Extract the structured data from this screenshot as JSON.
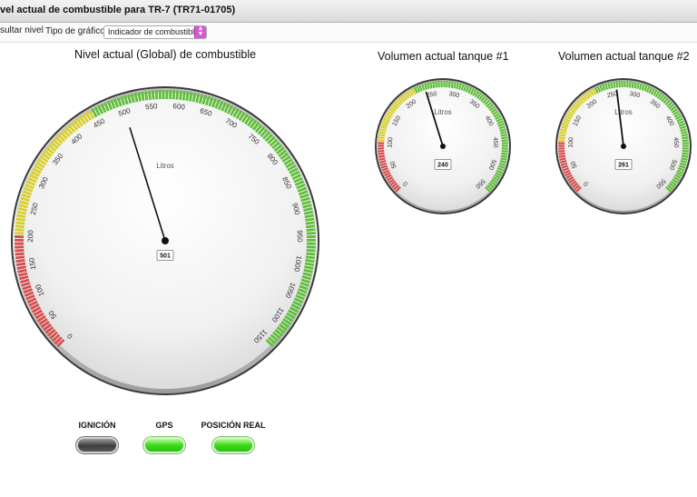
{
  "window": {
    "title": "vel actual de combustible para TR-7 (TR71-01705)"
  },
  "toolbar": {
    "consult_button": "sultar nivel",
    "chart_type_label": "Tipo de gráfico",
    "chart_type_value": "Indicador de combustible"
  },
  "colors": {
    "green": "#5fbf3a",
    "yellow": "#d9d02a",
    "red": "#d94c4c",
    "indicator_on": "#3cd81a",
    "indicator_off": "#3c3c3c"
  },
  "gauges": [
    {
      "title": "Nivel actual (Global) de combustible",
      "unit": "Litros",
      "value": 501,
      "readout": "501",
      "min": 0,
      "max": 1150,
      "ticks": [
        "0",
        "50",
        "100",
        "150",
        "200",
        "250",
        "300",
        "350",
        "400",
        "450",
        "500",
        "550",
        "600",
        "650",
        "700",
        "750",
        "800",
        "850",
        "900",
        "950",
        "1000",
        "1050",
        "1100",
        "1150"
      ],
      "bands": [
        {
          "from": 0,
          "to": 200,
          "color": "red"
        },
        {
          "from": 200,
          "to": 450,
          "color": "yellow"
        },
        {
          "from": 450,
          "to": 1150,
          "color": "green"
        }
      ]
    },
    {
      "title": "Volumen actual tanque #1",
      "unit": "Litros",
      "value": 240,
      "readout": "240",
      "min": 0,
      "max": 550,
      "ticks": [
        "0",
        "50",
        "100",
        "150",
        "200",
        "250",
        "300",
        "350",
        "400",
        "450",
        "500",
        "550"
      ],
      "bands": [
        {
          "from": 0,
          "to": 100,
          "color": "red"
        },
        {
          "from": 100,
          "to": 220,
          "color": "yellow"
        },
        {
          "from": 220,
          "to": 550,
          "color": "green"
        }
      ]
    },
    {
      "title": "Volumen actual tanque #2",
      "unit": "Litros",
      "value": 261,
      "readout": "261",
      "min": 0,
      "max": 550,
      "ticks": [
        "0",
        "50",
        "100",
        "150",
        "200",
        "250",
        "300",
        "350",
        "400",
        "450",
        "500",
        "550"
      ],
      "bands": [
        {
          "from": 0,
          "to": 100,
          "color": "red"
        },
        {
          "from": 100,
          "to": 220,
          "color": "yellow"
        },
        {
          "from": 220,
          "to": 550,
          "color": "green"
        }
      ]
    }
  ],
  "indicators": [
    {
      "label": "IGNICIÓN",
      "state": "off"
    },
    {
      "label": "GPS",
      "state": "on"
    },
    {
      "label": "POSICIÓN REAL",
      "state": "on"
    }
  ]
}
